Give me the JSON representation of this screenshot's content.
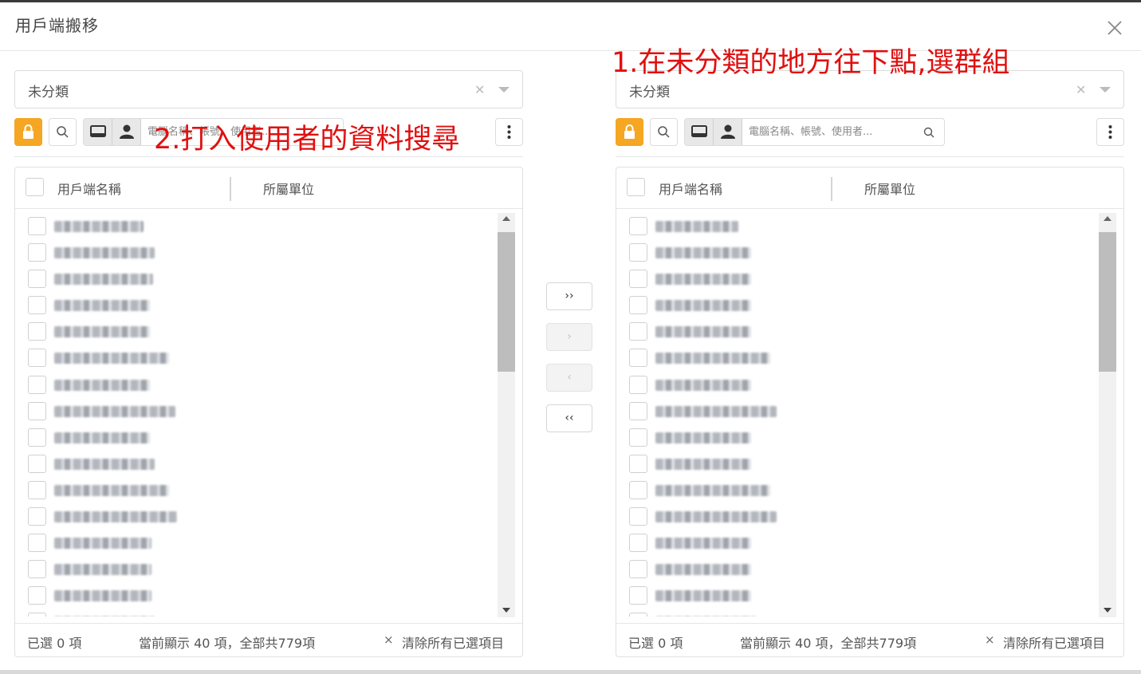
{
  "dialog": {
    "title": "用戶端搬移",
    "close_icon": "close-icon"
  },
  "annotations": {
    "step1": "1.在未分類的地方往下點,選群組",
    "step2": "2.打入使用者的資料搜尋"
  },
  "left_panel": {
    "select_value": "未分類",
    "search_placeholder": "電腦名稱、帳號、使用者...",
    "col_name": "用戶端名稱",
    "col_unit": "所屬單位",
    "selected_text": "已選 0 項",
    "showing_text": "當前顯示 40 項，全部共779項",
    "clear_x": "×",
    "clear_text": "清除所有已選項目"
  },
  "right_panel": {
    "select_value": "未分類",
    "search_placeholder": "電腦名稱、帳號、使用者...",
    "col_name": "用戶端名稱",
    "col_unit": "所屬單位",
    "selected_text": "已選 0 項",
    "showing_text": "當前顯示 40 項，全部共779項",
    "clear_x": "×",
    "clear_text": "清除所有已選項目"
  },
  "transfer_buttons": {
    "move_all_right": "››",
    "move_right": "›",
    "move_left": "‹",
    "move_all_left": "‹‹"
  },
  "colors": {
    "accent": "#f5a623",
    "annotation": "#e01010"
  }
}
